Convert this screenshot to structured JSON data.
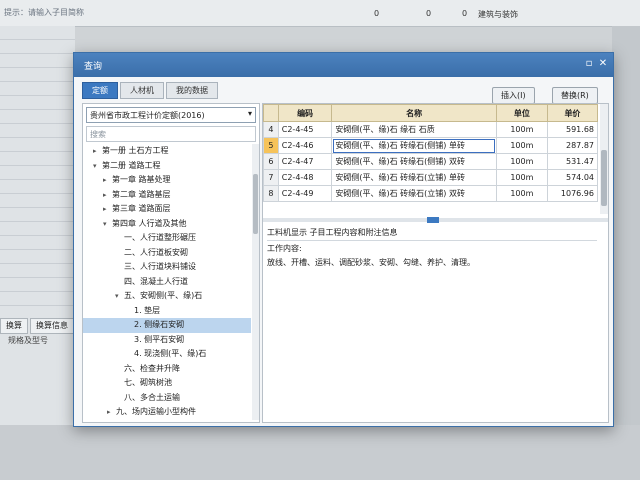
{
  "background": {
    "hint": "提示：请输入子目简称",
    "row": {
      "v1": "0",
      "v2": "0",
      "v3": "0",
      "category": "建筑与装饰"
    },
    "tabs": [
      "换算",
      "换算信息"
    ],
    "field_label": "规格及型号"
  },
  "dialog": {
    "title": "查询",
    "tabs": [
      "定额",
      "人材机",
      "我的数据"
    ],
    "insert_button": "插入(I)",
    "replace_button": "替换(R)",
    "quota_select": "贵州省市政工程计价定额(2016)",
    "search_placeholder": "搜索",
    "tree": [
      {
        "label": "第一册 土石方工程",
        "caret": "▸"
      },
      {
        "label": "第二册 道路工程",
        "caret": "▾"
      },
      {
        "label": "第一章 路基处理",
        "caret": "▸"
      },
      {
        "label": "第二章 道路基层",
        "caret": "▸"
      },
      {
        "label": "第三章 道路面层",
        "caret": "▸"
      },
      {
        "label": "第四章 人行道及其他",
        "caret": "▾"
      },
      {
        "label": "一、人行道整形碾压",
        "caret": ""
      },
      {
        "label": "二、人行道板安砌",
        "caret": ""
      },
      {
        "label": "三、人行道块料铺设",
        "caret": ""
      },
      {
        "label": "四、混凝土人行道",
        "caret": ""
      },
      {
        "label": "五、安砌侧(平、缘)石",
        "caret": "▾"
      },
      {
        "label": "1. 垫层",
        "caret": ""
      },
      {
        "label": "2. 侧缘石安砌",
        "caret": ""
      },
      {
        "label": "3. 侧平石安砌",
        "caret": ""
      },
      {
        "label": "4. 现浇侧(平、缘)石",
        "caret": ""
      },
      {
        "label": "六、检查井升降",
        "caret": ""
      },
      {
        "label": "七、砌筑树池",
        "caret": ""
      },
      {
        "label": "八、多合土运输",
        "caret": ""
      },
      {
        "label": "九、场内运输小型构件",
        "caret": "▸"
      }
    ],
    "table": {
      "headers": [
        "",
        "编码",
        "名称",
        "单位",
        "单价"
      ],
      "rows": [
        {
          "n": "4",
          "code": "C2-4-45",
          "name": "安砌侧(平、缘)石 缘石 石质",
          "unit": "100m",
          "price": "591.68"
        },
        {
          "n": "5",
          "code": "C2-4-46",
          "name": "安砌侧(平、缘)石 砖缘石(侧铺) 单砖",
          "unit": "100m",
          "price": "287.87"
        },
        {
          "n": "6",
          "code": "C2-4-47",
          "name": "安砌侧(平、缘)石 砖缘石(侧铺) 双砖",
          "unit": "100m",
          "price": "531.47"
        },
        {
          "n": "7",
          "code": "C2-4-48",
          "name": "安砌侧(平、缘)石 砖缘石(立铺) 单砖",
          "unit": "100m",
          "price": "574.04"
        },
        {
          "n": "8",
          "code": "C2-4-49",
          "name": "安砌侧(平、缘)石 砖缘石(立铺) 双砖",
          "unit": "100m",
          "price": "1076.96"
        }
      ]
    },
    "info_tabs": "工料机显示  子目工程内容和附注信息",
    "work_label": "工作内容:",
    "work_content": "放线、开槽、运料、调配砂浆、安砌、勾缝、养护、清理。"
  }
}
